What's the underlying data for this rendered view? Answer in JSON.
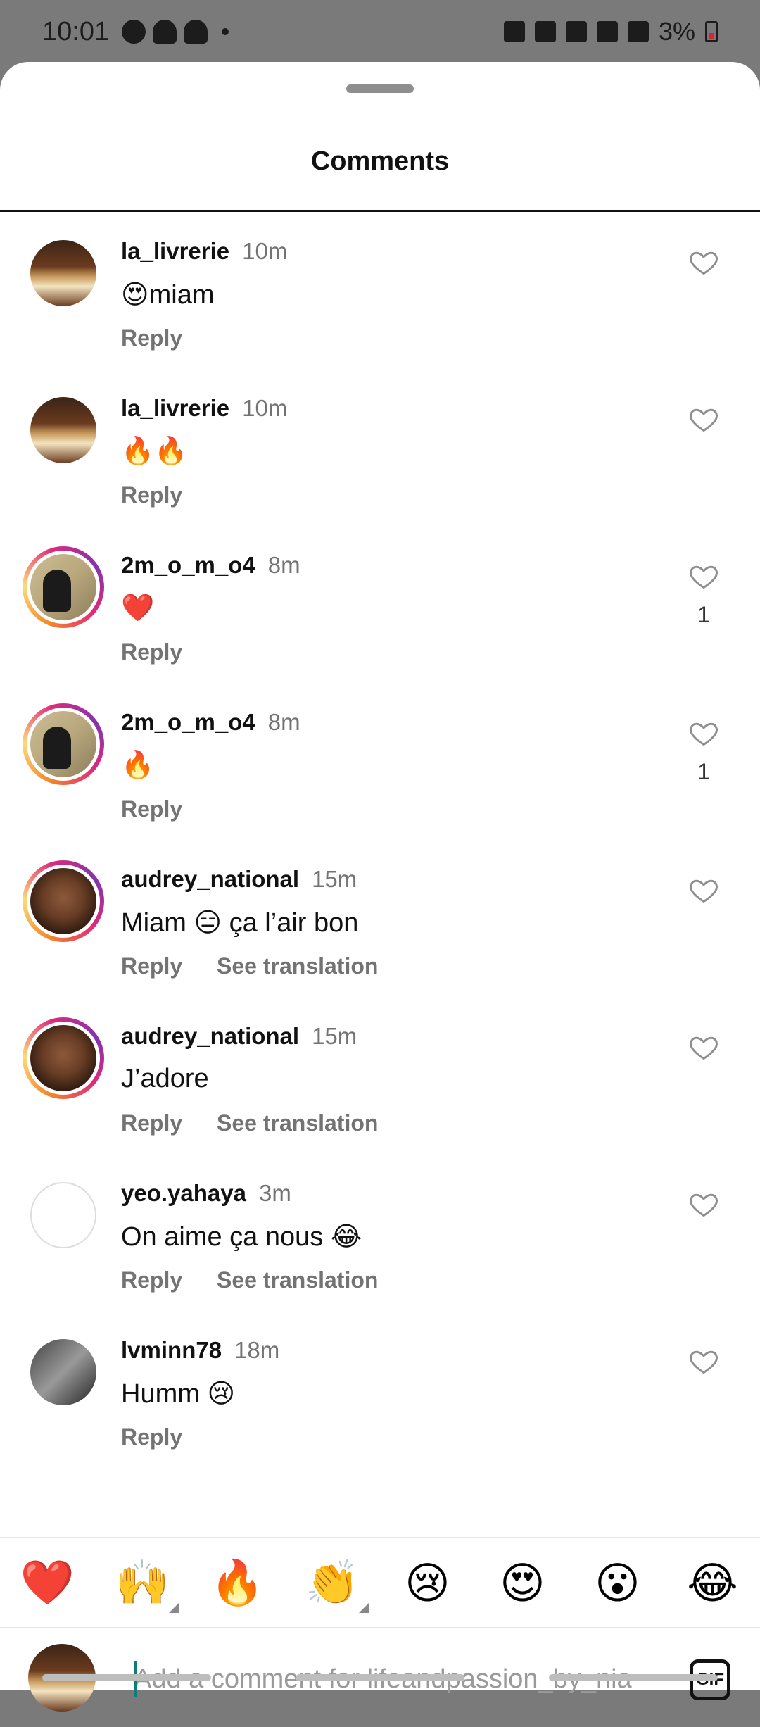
{
  "status_bar": {
    "time": "10:01",
    "battery": "3%"
  },
  "sheet": {
    "title": "Comments"
  },
  "comments": [
    {
      "username": "la_livrerie",
      "time": "10m",
      "text": "😍miam",
      "reply": "Reply",
      "translate": "",
      "likes": "",
      "avatar": "books",
      "story": false
    },
    {
      "username": "la_livrerie",
      "time": "10m",
      "text": "🔥🔥",
      "reply": "Reply",
      "translate": "",
      "likes": "",
      "avatar": "books",
      "story": false
    },
    {
      "username": "2m_o_m_o4",
      "time": "8m",
      "text": "❤️",
      "reply": "Reply",
      "translate": "",
      "likes": "1",
      "avatar": "wall",
      "story": true
    },
    {
      "username": "2m_o_m_o4",
      "time": "8m",
      "text": "🔥",
      "reply": "Reply",
      "translate": "",
      "likes": "1",
      "avatar": "wall",
      "story": true
    },
    {
      "username": "audrey_national",
      "time": "15m",
      "text": "Miam 😑 ça l’air bon",
      "reply": "Reply",
      "translate": "See translation",
      "likes": "",
      "avatar": "face",
      "story": true
    },
    {
      "username": "audrey_national",
      "time": "15m",
      "text": "J’adore",
      "reply": "Reply",
      "translate": "See translation",
      "likes": "",
      "avatar": "face",
      "story": true
    },
    {
      "username": "yeo.yahaya",
      "time": "3m",
      "text": "On aime ça nous 😂",
      "reply": "Reply",
      "translate": "See translation",
      "likes": "",
      "avatar": "crown",
      "story": false
    },
    {
      "username": "lvminn78",
      "time": "18m",
      "text": "Humm 😢",
      "reply": "Reply",
      "translate": "",
      "likes": "",
      "avatar": "bw",
      "story": false
    }
  ],
  "emoji_bar": [
    {
      "emoji": "❤️",
      "name": "red-heart",
      "variants": false
    },
    {
      "emoji": "🙌",
      "name": "raised-hands",
      "variants": true
    },
    {
      "emoji": "🔥",
      "name": "fire",
      "variants": false
    },
    {
      "emoji": "👏",
      "name": "clapping-hands",
      "variants": true
    },
    {
      "emoji": "😢",
      "name": "crying-face",
      "variants": false
    },
    {
      "emoji": "😍",
      "name": "heart-eyes",
      "variants": false
    },
    {
      "emoji": "😮",
      "name": "surprised-face",
      "variants": false
    },
    {
      "emoji": "😂",
      "name": "tears-of-joy",
      "variants": false
    }
  ],
  "composer": {
    "placeholder": "Add a comment for lifeandpassion_by_nia",
    "gif_label": "GIF"
  },
  "colors": {
    "text": "#111111",
    "muted": "#737373",
    "cursor": "#0b7f72"
  }
}
